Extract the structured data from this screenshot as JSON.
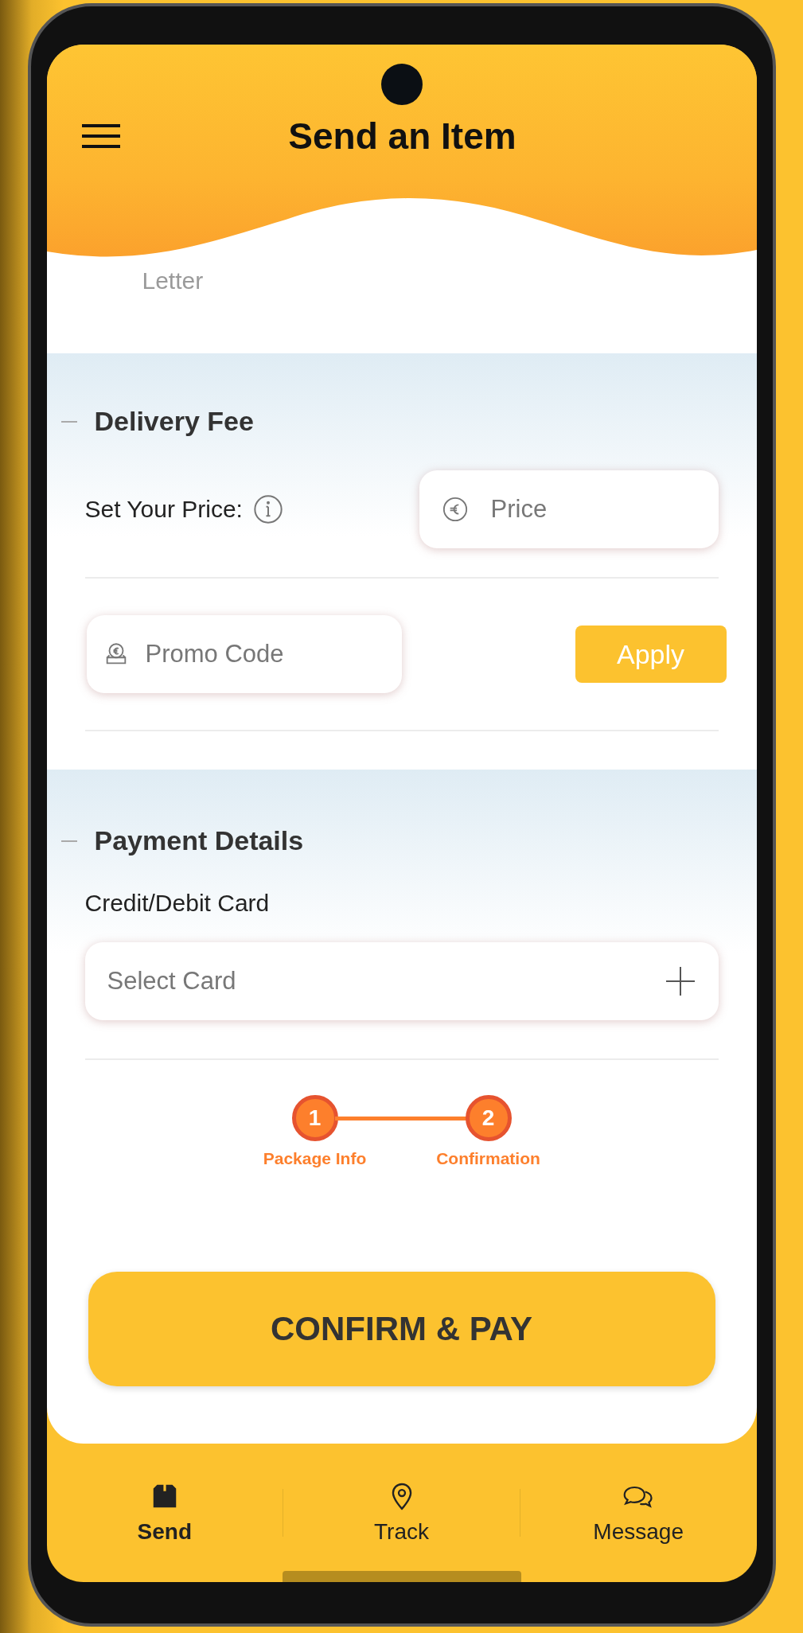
{
  "header": {
    "title": "Send an Item"
  },
  "package_row": {
    "type": "Letter"
  },
  "delivery_fee": {
    "heading": "Delivery Fee",
    "price_label": "Set Your Price:",
    "price_field": {
      "placeholder": "Price"
    },
    "promo_field": {
      "placeholder": "Promo Code"
    },
    "apply_button": "Apply"
  },
  "payment": {
    "heading": "Payment Details",
    "card_label": "Credit/Debit Card",
    "card_field": {
      "placeholder": "Select Card"
    }
  },
  "steps": [
    {
      "number": "1",
      "label": "Package Info"
    },
    {
      "number": "2",
      "label": "Confirmation"
    }
  ],
  "confirm_button": "CONFIRM & PAY",
  "nav": [
    {
      "kind": "box",
      "label": "Send",
      "selected": true
    },
    {
      "kind": "pin",
      "label": "Track",
      "selected": false
    },
    {
      "kind": "chat",
      "label": "Message",
      "selected": false
    }
  ]
}
